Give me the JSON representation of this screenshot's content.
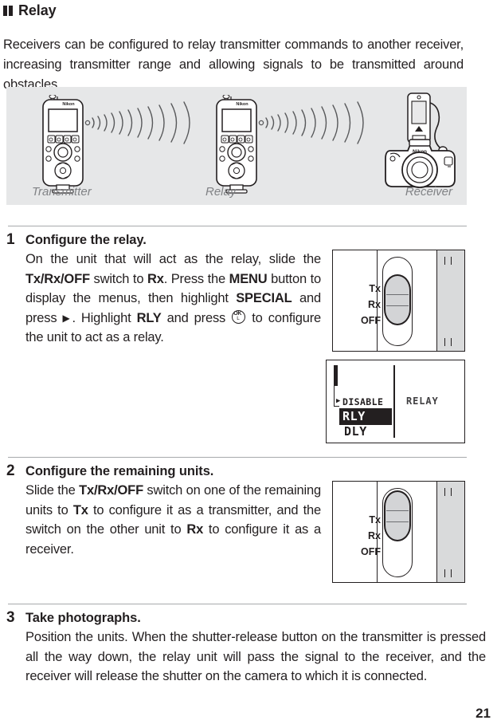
{
  "section": {
    "marker_icon": "double-bar-marker-icon",
    "title": "Relay",
    "intro": "Receivers can be configured to relay transmitter commands to another receiver, increasing transmitter range and allowing signals to be transmitted around obstacles."
  },
  "illustration": {
    "captions": {
      "transmitter": "Transmitter",
      "relay": "Relay",
      "receiver": "Receiver"
    },
    "devices": [
      {
        "name": "remote-transmitter-unit",
        "brand": "Nikon"
      },
      {
        "name": "remote-relay-unit",
        "brand": "Nikon"
      },
      {
        "name": "camera-with-receiver-unit",
        "brand": "Nikon"
      }
    ],
    "signal_icon": "radio-wave-icon",
    "background_color": "#e6e7e8"
  },
  "steps": [
    {
      "number": "1",
      "title": "Configure the relay.",
      "body_parts": [
        {
          "t": "On the unit that will act as the relay, slide the ",
          "b": false
        },
        {
          "t": "Tx/Rx/OFF",
          "b": true
        },
        {
          "t": " switch to ",
          "b": false
        },
        {
          "t": "Rx",
          "b": true
        },
        {
          "t": ". Press the ",
          "b": false
        },
        {
          "t": "MENU",
          "b": true
        },
        {
          "t": " button to display the menus, then highlight ",
          "b": false
        },
        {
          "t": "SPECIAL",
          "b": true
        },
        {
          "t": " and press ",
          "b": false
        },
        {
          "t": "▶",
          "b": false,
          "glyph": "right-arrow-icon"
        },
        {
          "t": ". Highlight ",
          "b": false
        },
        {
          "t": "RLY",
          "b": true
        },
        {
          "t": " and press ",
          "b": false
        },
        {
          "t": "OK",
          "b": false,
          "glyph": "ok-button-icon"
        },
        {
          "t": " to configure the unit to act as a relay.",
          "b": false
        }
      ]
    },
    {
      "number": "2",
      "title": "Configure the remaining units.",
      "body_parts": [
        {
          "t": "Slide the ",
          "b": false
        },
        {
          "t": "Tx/Rx/OFF",
          "b": true
        },
        {
          "t": " switch on one of the remaining units to ",
          "b": false
        },
        {
          "t": "Tx",
          "b": true
        },
        {
          "t": " to configure it as a transmitter, and the switch on the other unit to ",
          "b": false
        },
        {
          "t": "Rx",
          "b": true
        },
        {
          "t": " to configure it as a receiver.",
          "b": false
        }
      ]
    },
    {
      "number": "3",
      "title": "Take photographs.",
      "body_parts": [
        {
          "t": "Position the units. When the shutter-release button on the transmitter is pressed all the way down, the relay unit will pass the signal to the receiver, and the receiver will release the shutter on the camera to which it is connected.",
          "b": false
        }
      ]
    }
  ],
  "figures": {
    "switch_step1": {
      "name": "tx-rx-off-switch-set-to-rx",
      "labels": [
        "Tx",
        "Rx",
        "OFF"
      ],
      "position": "Rx"
    },
    "switch_step2": {
      "name": "tx-rx-off-switch-set-to-tx",
      "labels": [
        "Tx",
        "Rx",
        "OFF"
      ],
      "position": "Tx"
    },
    "lcd": {
      "name": "special-menu-screen",
      "menu_items": [
        "DISABLE",
        "RLY",
        "DLY"
      ],
      "selected": "RLY",
      "caret_item": "DISABLE",
      "right_label": "RELAY"
    }
  },
  "page_number": "21"
}
